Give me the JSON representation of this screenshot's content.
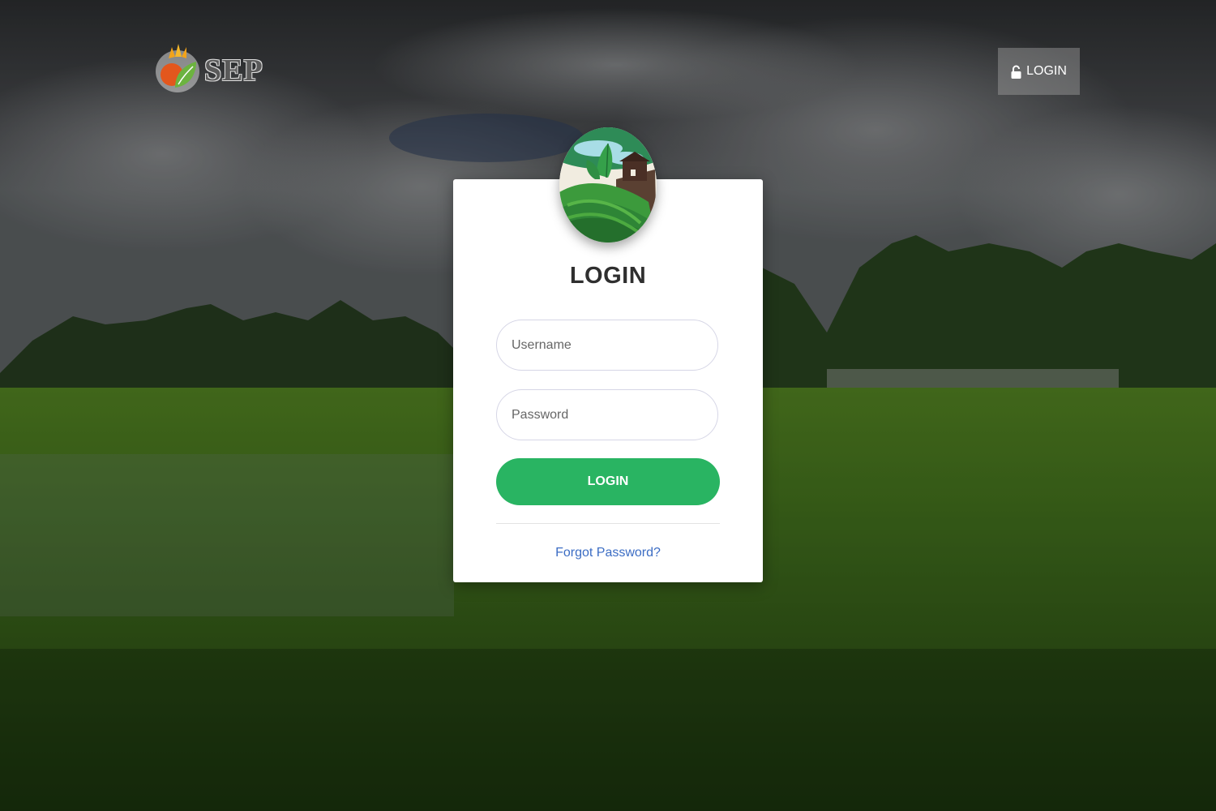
{
  "brand": {
    "name": "SEP"
  },
  "nav": {
    "login_label": "LOGIN",
    "login_icon": "lock-icon"
  },
  "login_card": {
    "avatar_icon": "farm-field-icon",
    "title": "LOGIN",
    "username": {
      "placeholder": "Username",
      "value": ""
    },
    "password": {
      "placeholder": "Password",
      "value": ""
    },
    "submit_label": "LOGIN",
    "forgot_label": "Forgot Password?"
  },
  "colors": {
    "accent": "#29b462",
    "link": "#3c6dc4",
    "card_bg": "#ffffff",
    "title_text": "#2f2f2f"
  }
}
